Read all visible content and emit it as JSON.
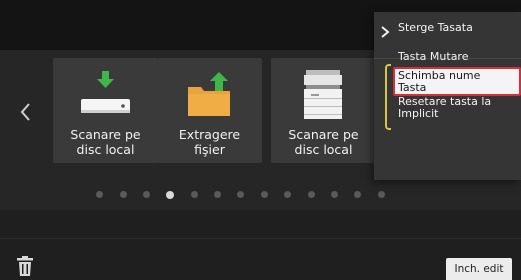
{
  "home": {
    "nav_left_icon": "chevron-left-icon",
    "tiles": [
      {
        "label": "Scanare pe\ndisc local",
        "icon": "scan-to-local-disk-icon"
      },
      {
        "label": "Extragere\nfişier",
        "icon": "file-retrieve-folder-icon"
      },
      {
        "label": "Scanare pe\ndisc local",
        "icon": "multifunction-printer-icon"
      }
    ],
    "pager": {
      "total": 13,
      "active": 3
    }
  },
  "context_menu": {
    "items": [
      {
        "label": "Sterge Tasata"
      },
      {
        "label": "Tasta Mutare"
      },
      {
        "label": "Schimba nume\nTasta"
      },
      {
        "label": "Resetare tasta la\nImplicit"
      }
    ],
    "selected_index": 2,
    "highlight_color": "#d3303a"
  },
  "footer": {
    "edit_label": "Inch. edit",
    "trash_icon": "trash-icon"
  },
  "colors": {
    "accent_yellow": "#d8c64a",
    "icon_green": "#3fb54a",
    "folder_orange": "#e8a33c"
  }
}
